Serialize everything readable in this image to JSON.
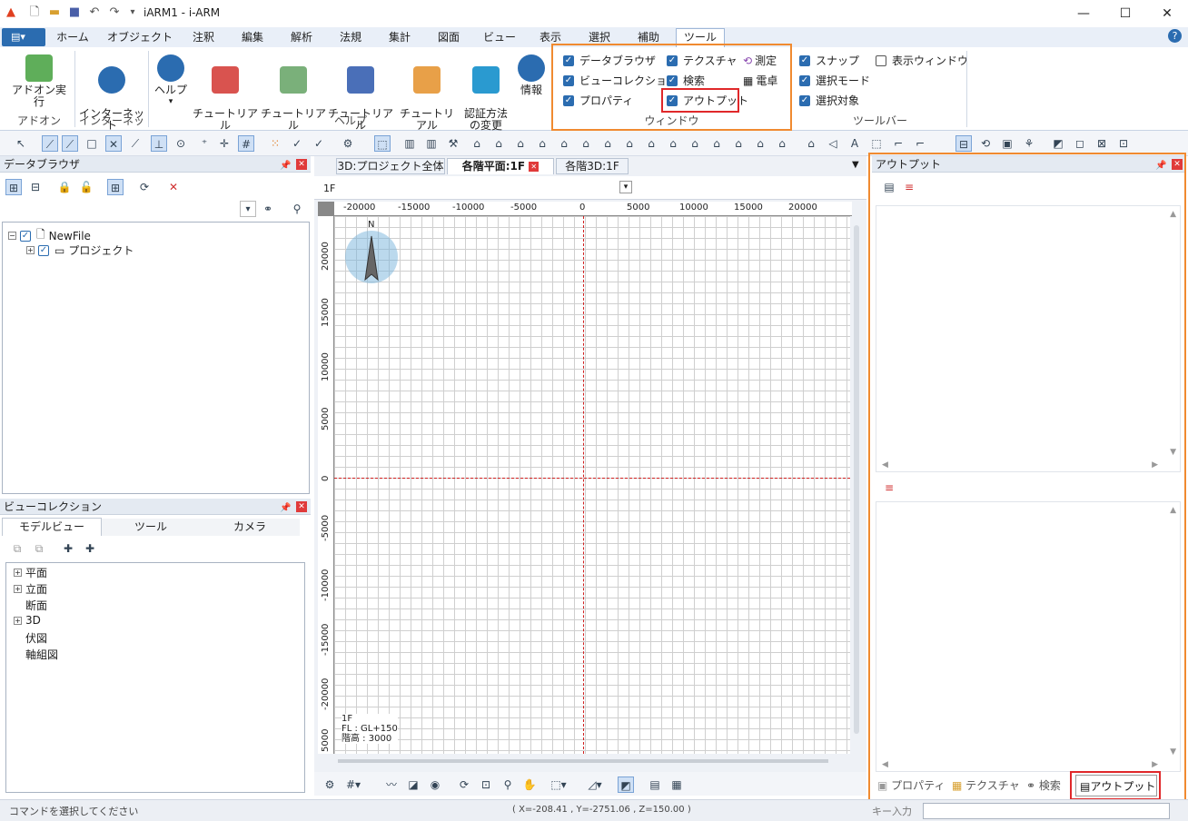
{
  "app": {
    "title": "iARM1 - i-ARM"
  },
  "menu": {
    "tabs": [
      "ホーム",
      "オブジェクト",
      "注釈",
      "編集",
      "解析",
      "法規",
      "集計",
      "図面",
      "ビュー",
      "表示",
      "選択",
      "補助",
      "ツール"
    ],
    "active": "ツール"
  },
  "ribbon": {
    "addon": {
      "exec": "アドオン実行",
      "group": "アドオン"
    },
    "internet": {
      "update": "インターネット\nアップデート",
      "group": "インターネット"
    },
    "help": {
      "items": [
        "ヘルプ",
        "チュートリアル\nモデル入力編",
        "チュートリアル\nモデル解析編",
        "チュートリアル\n法規確認編",
        "チュートリアル\n表作成編",
        "認証方法\nの変更",
        "情報"
      ],
      "group": "ヘルプ"
    },
    "window": {
      "items": [
        {
          "label": "データブラウザ",
          "checked": true
        },
        {
          "label": "ビューコレクション",
          "checked": true
        },
        {
          "label": "プロパティ",
          "checked": true
        },
        {
          "label": "テクスチャ",
          "checked": true
        },
        {
          "label": "検索",
          "checked": true
        },
        {
          "label": "アウトプット",
          "checked": true
        }
      ],
      "measure": "測定",
      "calc": "電卓",
      "group": "ウィンドウ"
    },
    "toolbar": {
      "items": [
        {
          "label": "スナップ",
          "checked": true
        },
        {
          "label": "選択モード",
          "checked": true
        },
        {
          "label": "選択対象",
          "checked": true
        },
        {
          "label": "表示ウィンドウ",
          "checked": false
        }
      ],
      "group": "ツールバー"
    }
  },
  "databrowser": {
    "title": "データブラウザ",
    "tree": [
      "NewFile",
      "プロジェクト"
    ]
  },
  "viewcollection": {
    "title": "ビューコレクション",
    "tabs": [
      "モデルビュー",
      "ツール",
      "カメラ"
    ],
    "tree": [
      "平面",
      "立面",
      "断面",
      "3D",
      "伏図",
      "軸組図"
    ]
  },
  "doc": {
    "tabs": [
      "3D:プロジェクト全体",
      "各階平面:1F",
      "各階3D:1F"
    ],
    "floor": "1F",
    "hruler": [
      "-20000",
      "-15000",
      "-10000",
      "-5000",
      "0",
      "5000",
      "10000",
      "15000",
      "20000"
    ],
    "vruler": [
      "20000",
      "15000",
      "10000",
      "5000",
      "0",
      "-5000",
      "-10000",
      "-15000",
      "-20000",
      "5000"
    ],
    "north": "N",
    "info": [
      "1F",
      "FL : GL+150",
      "階高 : 3000"
    ]
  },
  "output": {
    "title": "アウトプット",
    "tabs": [
      "プロパティ",
      "テクスチャ",
      "検索",
      "アウトプット"
    ]
  },
  "status": {
    "left": "コマンドを選択してください",
    "coords": "( X=-208.41 , Y=-2751.06 , Z=150.00 )",
    "key": "キー入力"
  }
}
